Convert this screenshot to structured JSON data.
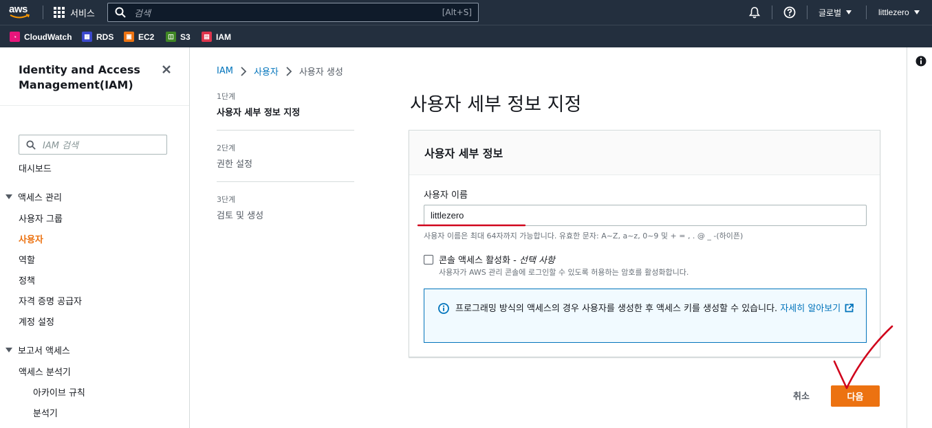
{
  "topnav": {
    "logo_text": "aws",
    "services_label": "서비스",
    "search_placeholder": "검색",
    "search_shortcut": "[Alt+S]",
    "region_label": "글로벌",
    "user_label": "littlezero"
  },
  "favorites": [
    {
      "label": "CloudWatch",
      "color": "#e7157b"
    },
    {
      "label": "RDS",
      "color": "#3b48cc"
    },
    {
      "label": "EC2",
      "color": "#ec7211"
    },
    {
      "label": "S3",
      "color": "#3f8624"
    },
    {
      "label": "IAM",
      "color": "#dd344c"
    }
  ],
  "sidebar": {
    "title": "Identity and Access Management(IAM)",
    "search_placeholder": "IAM 검색",
    "dashboard": "대시보드",
    "section_access": "액세스 관리",
    "items_access": [
      "사용자 그룹",
      "사용자",
      "역할",
      "정책",
      "자격 증명 공급자",
      "계정 설정"
    ],
    "active_item": "사용자",
    "section_reports": "보고서 액세스",
    "items_reports": [
      "액세스 분석기"
    ],
    "items_reports_sub": [
      "아카이브 규칙",
      "분석기"
    ]
  },
  "breadcrumb": [
    "IAM",
    "사용자",
    "사용자 생성"
  ],
  "steps": [
    {
      "num": "1단계",
      "label": "사용자 세부 정보 지정"
    },
    {
      "num": "2단계",
      "label": "권한 설정"
    },
    {
      "num": "3단계",
      "label": "검토 및 생성"
    }
  ],
  "page_title": "사용자 세부 정보 지정",
  "panel": {
    "header": "사용자 세부 정보",
    "username_label": "사용자 이름",
    "username_value": "littlezero",
    "username_hint": "사용자 이름은 최대 64자까지 가능합니다. 유효한 문자: A~Z, a~z, 0~9 및 + = , . @ _ -(하이픈)",
    "console_label": "콘솔 액세스 활성화 - ",
    "console_optional": "선택 사항",
    "console_desc": "사용자가 AWS 관리 콘솔에 로그인할 수 있도록 허용하는 암호를 활성화합니다.",
    "console_checked": false,
    "info_text": "프로그래밍 방식의 액세스의 경우 사용자를 생성한 후 액세스 키를 생성할 수 있습니다. ",
    "info_link": "자세히 알아보기"
  },
  "actions": {
    "cancel": "취소",
    "next": "다음"
  },
  "colors": {
    "nav_bg": "#232f3e",
    "accent": "#ec7211",
    "link": "#0073bb",
    "annotation_red": "#d0021b"
  }
}
